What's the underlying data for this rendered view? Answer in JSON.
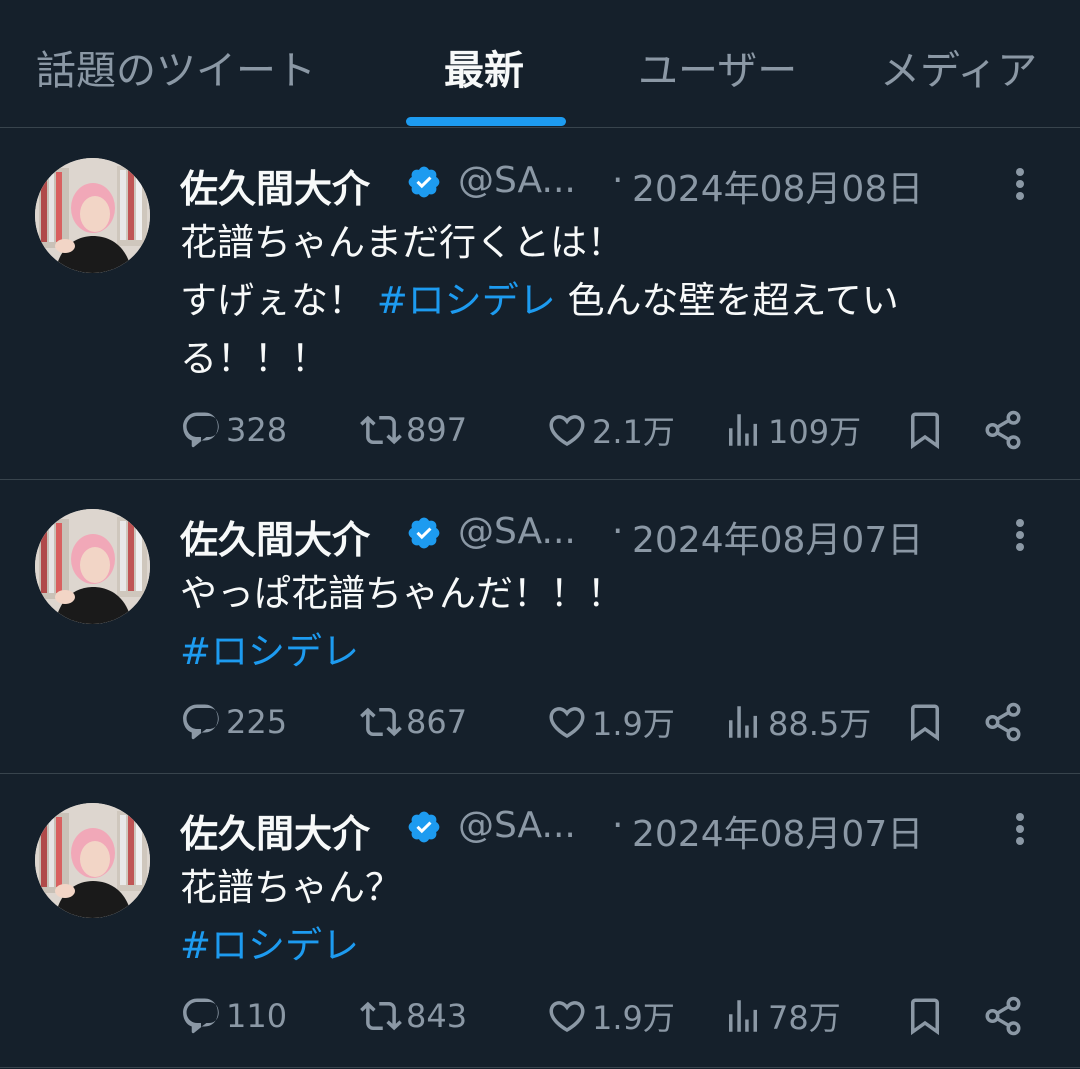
{
  "tabs": [
    {
      "label": "話題のツイート",
      "active": false
    },
    {
      "label": "最新",
      "active": true
    },
    {
      "label": "ユーザー",
      "active": false
    },
    {
      "label": "メディア",
      "active": false
    }
  ],
  "colors": {
    "background": "#15202b",
    "accent": "#1d9bf0",
    "muted": "#8b98a5",
    "text": "#f7f9f9",
    "divider": "#38444d"
  },
  "tweets": [
    {
      "author": "佐久間大介",
      "handle": "@SA...",
      "separator": "·",
      "date": "2024年08月08日",
      "lines": [
        {
          "text": "花譜ちゃんまだ行くとは！",
          "hashtag": "",
          "after": ""
        },
        {
          "text": "すげぇな！ ",
          "hashtag": "#ロシデレ",
          "after": " 色んな壁を超えてい"
        },
        {
          "text": "る！！！",
          "hashtag": "",
          "after": ""
        }
      ],
      "replies": "328",
      "retweets": "897",
      "likes": "2.1万",
      "views": "109万"
    },
    {
      "author": "佐久間大介",
      "handle": "@SA...",
      "separator": "·",
      "date": "2024年08月07日",
      "lines": [
        {
          "text": "やっぱ花譜ちゃんだ！！！",
          "hashtag": "",
          "after": ""
        },
        {
          "text": " ",
          "hashtag": "#ロシデレ",
          "after": ""
        }
      ],
      "replies": "225",
      "retweets": "867",
      "likes": "1.9万",
      "views": "88.5万"
    },
    {
      "author": "佐久間大介",
      "handle": "@SA...",
      "separator": "·",
      "date": "2024年08月07日",
      "lines": [
        {
          "text": "花譜ちゃん？",
          "hashtag": "",
          "after": ""
        },
        {
          "text": " ",
          "hashtag": "#ロシデレ",
          "after": ""
        }
      ],
      "replies": "110",
      "retweets": "843",
      "likes": "1.9万",
      "views": "78万"
    }
  ],
  "icons": {
    "verified": "verified-badge-icon",
    "more": "more-vertical-icon",
    "reply": "reply-icon",
    "retweet": "retweet-icon",
    "like": "heart-icon",
    "views": "views-chart-icon",
    "bookmark": "bookmark-icon",
    "share": "share-icon"
  }
}
